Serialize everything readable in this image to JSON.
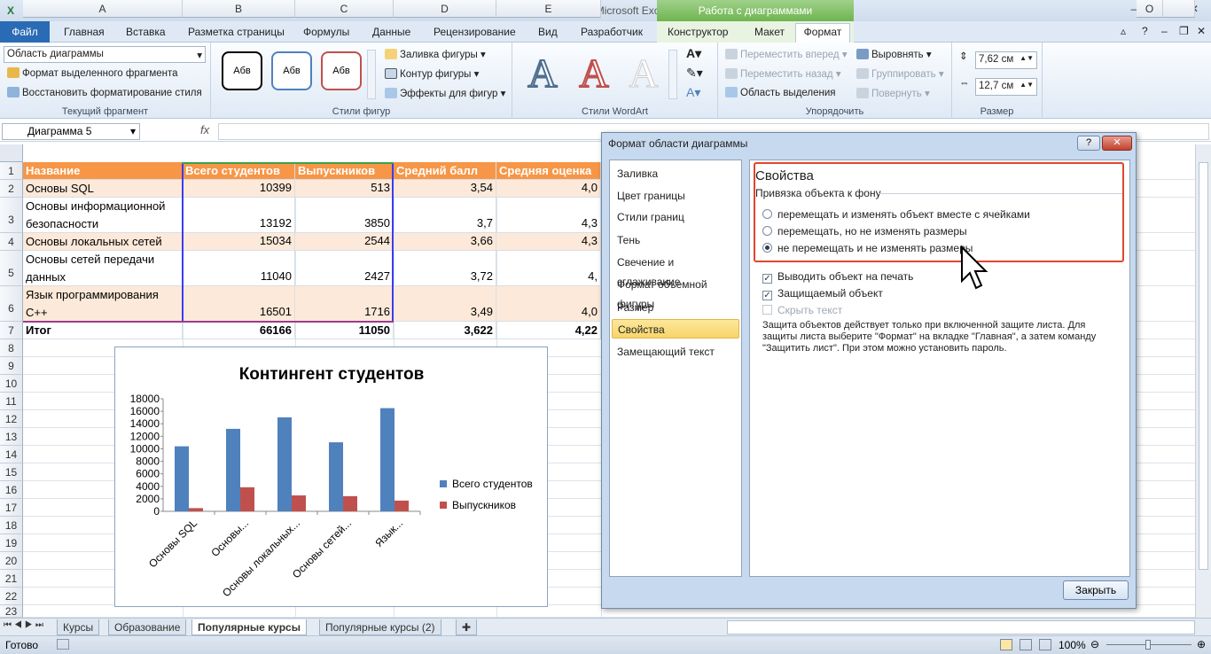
{
  "window": {
    "title": "ИНТУИТ - Microsoft Excel",
    "context_header": "Работа с диаграммами"
  },
  "tabs": [
    "Файл",
    "Главная",
    "Вставка",
    "Разметка страницы",
    "Формулы",
    "Данные",
    "Рецензирование",
    "Вид",
    "Разработчик"
  ],
  "context_tabs": [
    "Конструктор",
    "Макет",
    "Формат"
  ],
  "ribbon": {
    "current_fragment": {
      "dropdown": "Область диаграммы",
      "format_selection": "Формат выделенного фрагмента",
      "reset_style": "Восстановить форматирование стиля",
      "label": "Текущий фрагмент"
    },
    "shape_styles": {
      "swatch_text": "Абв",
      "fill": "Заливка фигуры",
      "outline": "Контур фигуры",
      "effects": "Эффекты для фигур",
      "label": "Стили фигур"
    },
    "wordart": {
      "glyph": "A",
      "label": "Стили WordArt"
    },
    "arrange": {
      "bring_forward": "Переместить вперед",
      "send_backward": "Переместить назад",
      "selection_pane": "Область выделения",
      "align": "Выровнять",
      "group": "Группировать",
      "rotate": "Повернуть",
      "label": "Упорядочить"
    },
    "size": {
      "height": "7,62 см",
      "width": "12,7 см",
      "label": "Размер"
    }
  },
  "formula_bar": {
    "name_box": "Диаграмма 5",
    "fx": "fx"
  },
  "columns": [
    "A",
    "B",
    "C",
    "D",
    "E",
    "O"
  ],
  "rows": [
    "1",
    "2",
    "3",
    "4",
    "5",
    "6",
    "7",
    "8",
    "9",
    "10",
    "11",
    "12",
    "13",
    "14",
    "15",
    "16",
    "17",
    "18",
    "19",
    "20",
    "21",
    "22",
    "23"
  ],
  "table": {
    "headers": [
      "Название",
      "Всего студентов",
      "Выпускников",
      "Средний балл",
      "Средняя оценка"
    ],
    "rows": [
      {
        "name": [
          "Основы SQL"
        ],
        "total": "10399",
        "grads": "513",
        "avg": "3,54",
        "grade": "4,0"
      },
      {
        "name": [
          "Основы информационной",
          "безопасности"
        ],
        "total": "13192",
        "grads": "3850",
        "avg": "3,7",
        "grade": "4,3"
      },
      {
        "name": [
          "Основы локальных сетей"
        ],
        "total": "15034",
        "grads": "2544",
        "avg": "3,66",
        "grade": "4,3"
      },
      {
        "name": [
          "Основы сетей передачи",
          "данных"
        ],
        "total": "11040",
        "grads": "2427",
        "avg": "3,72",
        "grade": "4,"
      },
      {
        "name": [
          "Язык программирования",
          "C++"
        ],
        "total": "16501",
        "grads": "1716",
        "avg": "3,49",
        "grade": "4,0"
      }
    ],
    "total": {
      "name": "Итог",
      "total": "66166",
      "grads": "11050",
      "avg": "3,622",
      "grade": "4,22"
    }
  },
  "chart_data": {
    "type": "bar",
    "title": "Контингент студентов",
    "categories": [
      "Основы SQL",
      "Основы...",
      "Основы локальных...",
      "Основы сетей...",
      "Язык..."
    ],
    "series": [
      {
        "name": "Всего студентов",
        "values": [
          10399,
          13192,
          15034,
          11040,
          16501
        ],
        "color": "#4f81bd"
      },
      {
        "name": "Выпускников",
        "values": [
          513,
          3850,
          2544,
          2427,
          1716
        ],
        "color": "#c0504d"
      }
    ],
    "ylim": [
      0,
      18000
    ],
    "yticks": [
      "0",
      "2000",
      "4000",
      "6000",
      "8000",
      "10000",
      "12000",
      "14000",
      "16000",
      "18000"
    ],
    "legend": "right",
    "grid": false
  },
  "sheets": [
    "Курсы",
    "Образование",
    "Популярные курсы",
    "Популярные курсы (2)"
  ],
  "active_sheet": 2,
  "status": {
    "ready": "Готово",
    "zoom": "100%"
  },
  "dialog": {
    "title": "Формат области диаграммы",
    "nav": [
      "Заливка",
      "Цвет границы",
      "Стили границ",
      "Тень",
      "Свечение и сглаживание",
      "Формат объемной фигуры",
      "Размер",
      "Свойства",
      "Замещающий текст"
    ],
    "selected_nav": 7,
    "heading": "Свойства",
    "anchor_label": "Привязка объекта к фону",
    "radio_options": [
      "перемещать и изменять объект вместе с ячейками",
      "перемещать, но не изменять размеры",
      "не перемещать и не изменять размеры"
    ],
    "selected_radio": 2,
    "print_object": "Выводить объект на печать",
    "locked": "Защищаемый объект",
    "hide_text": "Скрыть текст",
    "note": [
      "Защита объектов действует только при включенной защите листа. Для",
      "защиты листа выберите \"Формат\" на вкладке \"Главная\", а затем команду",
      "\"Защитить лист\". При этом можно установить пароль."
    ],
    "close": "Закрыть"
  },
  "colors": {
    "header_orange": "#f79646",
    "band": "#fde9d9",
    "file_tab": "#2a6bb5",
    "highlight_red": "#e0462f"
  }
}
